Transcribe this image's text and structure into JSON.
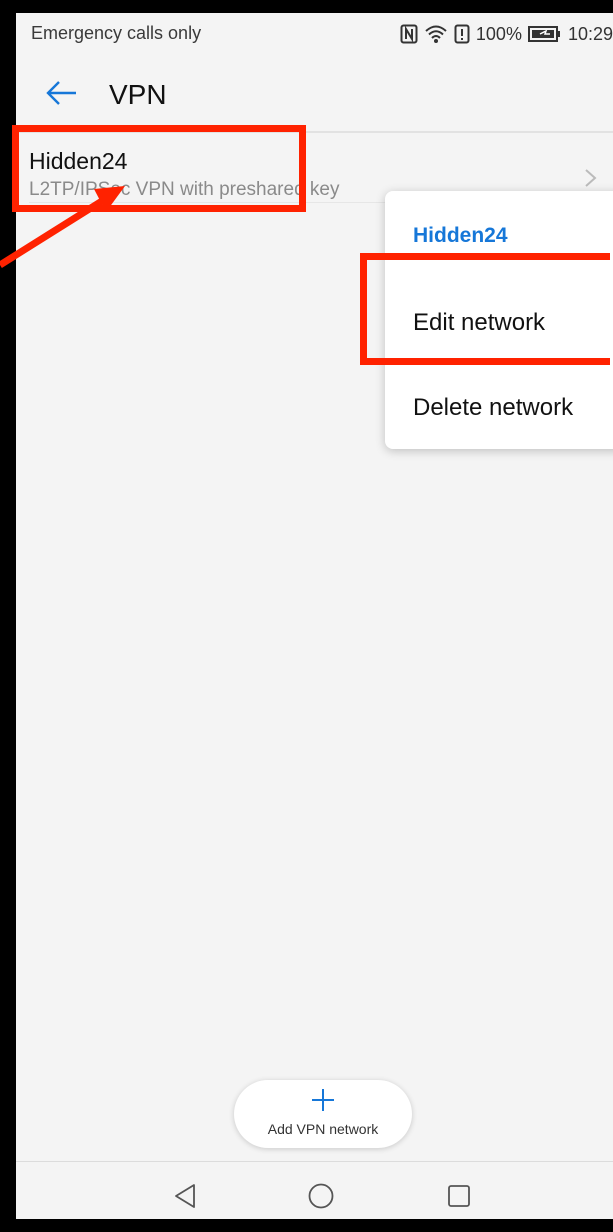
{
  "status_bar": {
    "carrier_text": "Emergency calls only",
    "battery": "100%",
    "time": "10:29",
    "icons": [
      "nfc-icon",
      "wifi-icon",
      "alert-icon",
      "battery-icon"
    ]
  },
  "header": {
    "title": "VPN",
    "back_icon": "back-arrow-icon"
  },
  "vpn_list": {
    "items": [
      {
        "name": "Hidden24",
        "type": "L2TP/IPSec VPN with preshared key"
      }
    ]
  },
  "context_menu": {
    "title": "Hidden24",
    "items": [
      {
        "label": "Edit network"
      },
      {
        "label": "Delete network"
      }
    ]
  },
  "fab": {
    "label": "Add VPN network",
    "icon": "plus-icon"
  },
  "nav_bar": {
    "buttons": [
      "back-triangle-icon",
      "home-circle-icon",
      "recents-square-icon"
    ]
  },
  "colors": {
    "accent": "#1677d8",
    "annotation": "#ff2200",
    "background": "#f4f4f4",
    "text_primary": "#111111",
    "text_secondary": "#8a8a8a"
  }
}
